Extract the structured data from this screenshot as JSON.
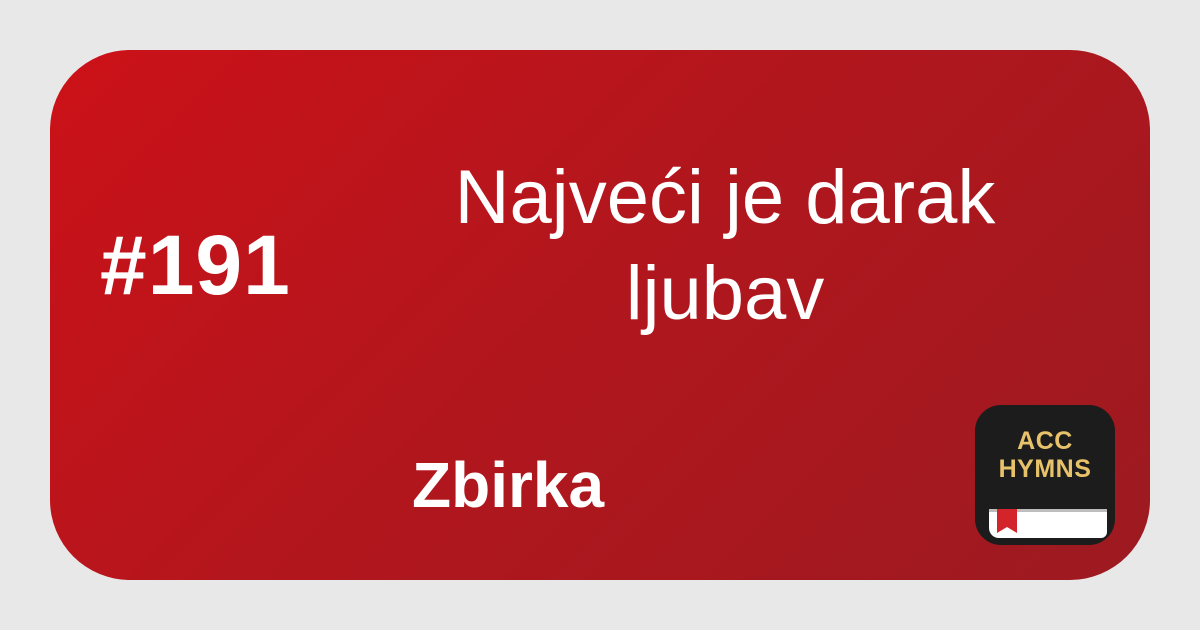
{
  "card": {
    "number": "#191",
    "title_line1": "Najveći je darak",
    "title_line2": "ljubav",
    "collection": "Zbirka"
  },
  "app_icon": {
    "line1": "ACC",
    "line2": "HYMNS",
    "icon": "book-with-bookmark-icon"
  },
  "colors": {
    "background": "#e8e8e8",
    "card_gradient_start": "#cc1118",
    "card_gradient_end": "#9c1a20",
    "text": "#ffffff",
    "app_icon_bg": "#1c1c1c",
    "app_icon_text": "#e7c26a",
    "bookmark": "#d2242a"
  }
}
